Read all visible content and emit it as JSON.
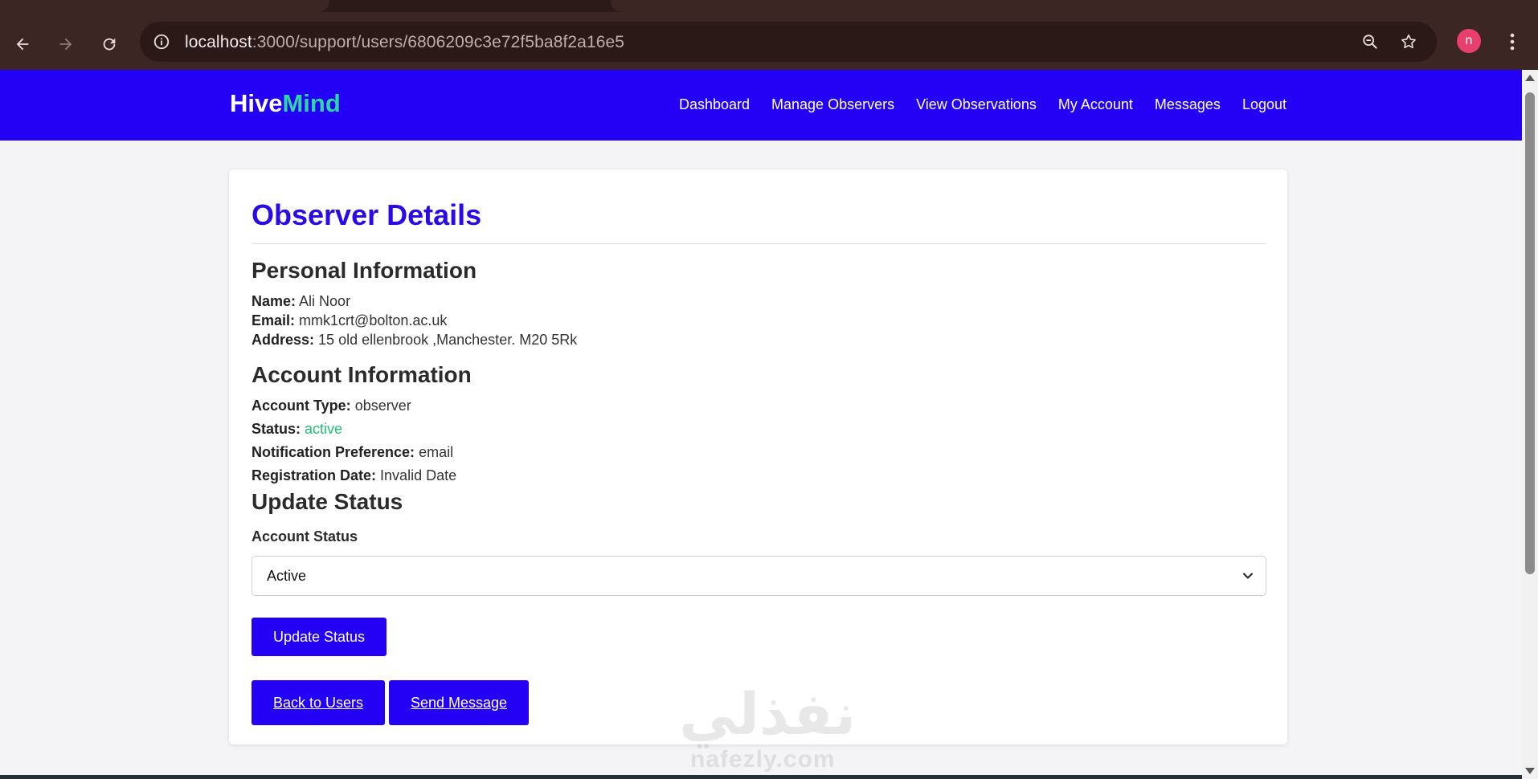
{
  "browser": {
    "url_host": "localhost",
    "url_path": ":3000/support/users/6806209c3e72f5ba8f2a16e5",
    "profile_initial": "n"
  },
  "site": {
    "logo_part1": "Hive",
    "logo_part2": "Mind",
    "nav": [
      "Dashboard",
      "Manage Observers",
      "View Observations",
      "My Account",
      "Messages",
      "Logout"
    ]
  },
  "page": {
    "title": "Observer Details",
    "personal": {
      "heading": "Personal Information",
      "name_label": "Name:",
      "name": "Ali Noor",
      "email_label": "Email:",
      "email": "mmk1crt@bolton.ac.uk",
      "address_label": "Address:",
      "address": "15 old ellenbrook ,Manchester. M20 5Rk"
    },
    "account": {
      "heading": "Account Information",
      "type_label": "Account Type:",
      "type": "observer",
      "status_label": "Status:",
      "status": "active",
      "notif_label": "Notification Preference:",
      "notif": "email",
      "reg_label": "Registration Date:",
      "reg": "Invalid Date"
    },
    "update": {
      "heading": "Update Status",
      "field_label": "Account Status",
      "selected": "Active",
      "button": "Update Status"
    },
    "actions": {
      "back": "Back to Users",
      "send": "Send Message"
    }
  },
  "watermark": {
    "arabic": "نفذلي",
    "latin": "nafezly.com"
  },
  "colors": {
    "brand": "#2400f5",
    "title": "#2a0ae8",
    "logo_accent": "#2fd6a3",
    "status_active": "#1fbf74"
  }
}
